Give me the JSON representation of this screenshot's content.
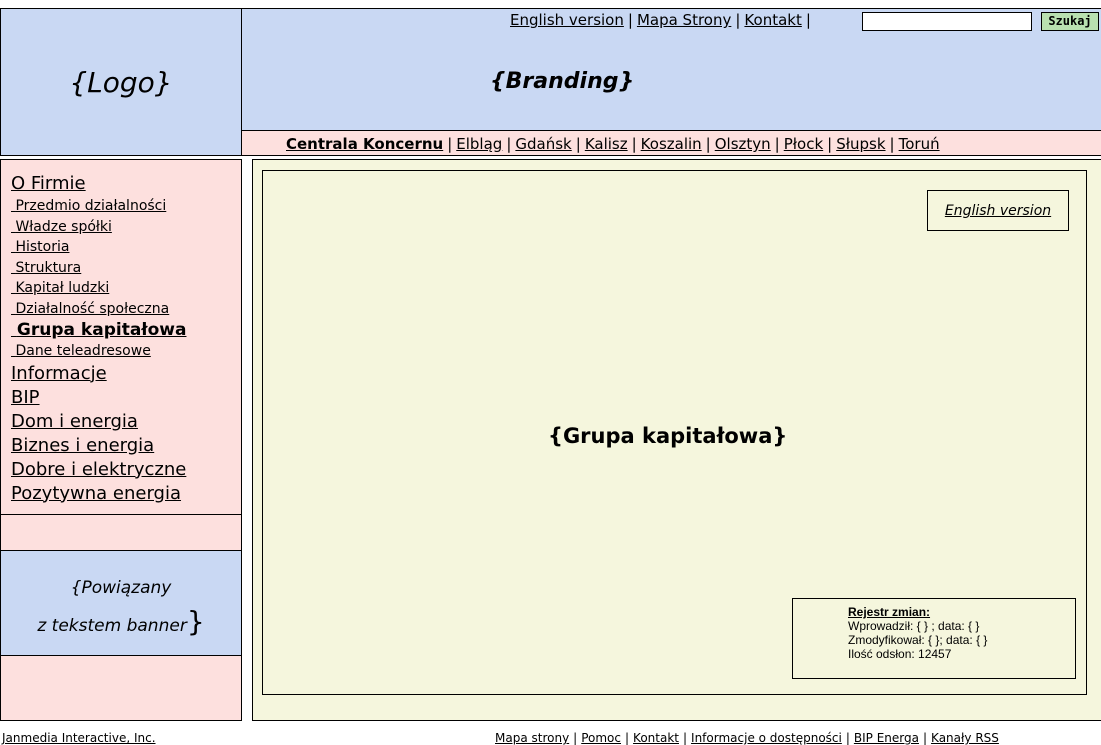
{
  "logo": {
    "text": "{Logo}"
  },
  "header": {
    "top_links": [
      "English version",
      "Mapa Strony",
      "Kontakt"
    ],
    "search": {
      "value": "",
      "button_label": "Szukaj"
    },
    "branding": "{Branding}"
  },
  "city_nav": {
    "main": "Centrala Koncernu",
    "cities": [
      "Elbląg",
      "Gdańsk",
      "Kalisz",
      "Koszalin",
      "Olsztyn",
      "Płock",
      "Słupsk",
      "Toruń"
    ]
  },
  "sidebar": {
    "firm": {
      "label": "O Firmie",
      "items": [
        "Przedmio działalności",
        "Władze spółki",
        "Historia",
        "Struktura",
        "Kapitał ludzki",
        "Działalność społeczna",
        "Grupa kapitałowa",
        "Dane teleadresowe"
      ],
      "current": "Grupa kapitałowa"
    },
    "top_items": [
      "Informacje",
      "BIP",
      "Dom i energia",
      "Biznes i energia",
      "Dobre i elektryczne",
      "Pozytywna energia"
    ],
    "banner": {
      "line1": "{Powiązany",
      "line2": "z tekstem banner",
      "brace": "}"
    }
  },
  "main": {
    "english_version": "English version",
    "title": "{Grupa kapitałowa}",
    "change_log": {
      "title": "Rejestr zmian:",
      "entered": "Wprowadził: { } ; data: { }",
      "modified": "Zmodyfikował: { }; data: { }",
      "views": "Ilość odsłon: 12457"
    }
  },
  "footer": {
    "company": "Janmedia Interactive, Inc.",
    "links": [
      "Mapa strony",
      "Pomoc",
      "Kontakt",
      "Informacje o dostępności",
      "BIP Energa",
      "Kanały RSS"
    ]
  },
  "colors": {
    "blue_panel": "#c9d8f3",
    "pink_panel": "#fde0de",
    "main_bg": "#f5f6dd",
    "search_button": "#b9e0b0"
  }
}
